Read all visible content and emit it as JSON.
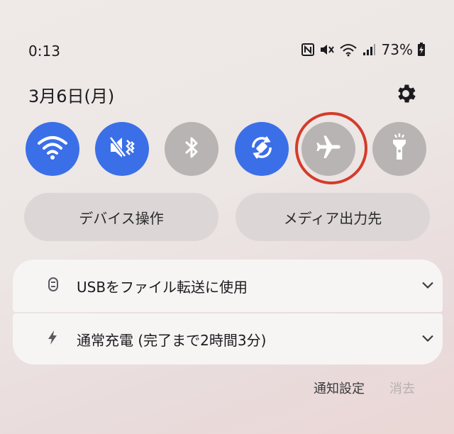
{
  "status_bar": {
    "time": "0:13",
    "battery_percent": "73%",
    "icons": [
      "nfc-icon",
      "mute-icon",
      "wifi-signal-icon",
      "cell-signal-icon",
      "battery-charging-icon"
    ]
  },
  "header": {
    "date": "3月6日(月)",
    "settings_icon": "gear-icon"
  },
  "quick_tiles": [
    {
      "name": "wifi",
      "icon": "wifi-icon",
      "state": "on"
    },
    {
      "name": "mute",
      "icon": "mute-icon",
      "state": "on"
    },
    {
      "name": "bluetooth",
      "icon": "bluetooth-icon",
      "state": "off"
    },
    {
      "name": "auto-rotate",
      "icon": "rotate-icon",
      "state": "on"
    },
    {
      "name": "airplane-mode",
      "icon": "airplane-icon",
      "state": "off",
      "highlighted": true
    },
    {
      "name": "flashlight",
      "icon": "flashlight-icon",
      "state": "off"
    }
  ],
  "pills": {
    "device_control": "デバイス操作",
    "media_output": "メディア出力先"
  },
  "notifications": [
    {
      "icon": "usb-icon",
      "label": "USBをファイル転送に使用"
    },
    {
      "icon": "charging-bolt-icon",
      "label": "通常充電 (完了まで2時間3分)"
    }
  ],
  "footer": {
    "notification_settings": "通知設定",
    "clear": "消去"
  },
  "colors": {
    "tile_on": "#3b6fe8",
    "tile_off": "#b8b4b3",
    "highlight_ring": "#d43b2a"
  }
}
